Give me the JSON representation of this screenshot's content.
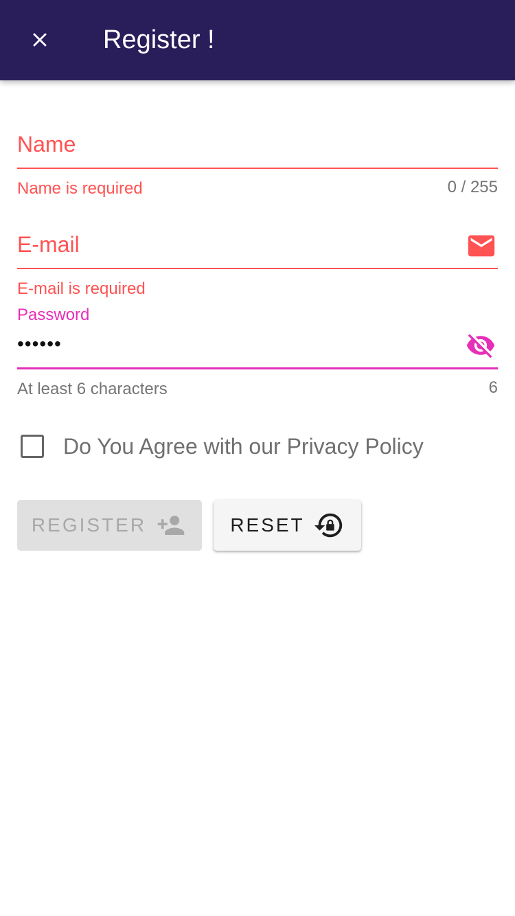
{
  "toolbar": {
    "title": "Register !",
    "close_icon": "close-icon",
    "background": "#291d5a"
  },
  "form": {
    "name": {
      "label": "Name",
      "value": "",
      "error": "Name is required",
      "counter": "0 / 255"
    },
    "email": {
      "label": "E-mail",
      "value": "",
      "error": "E-mail is required",
      "icon": "email-icon"
    },
    "password": {
      "label": "Password",
      "value_masked": "••••••",
      "hint": "At least 6 characters",
      "counter": "6",
      "icon": "eye-off-icon"
    },
    "privacy_checkbox": {
      "label": "Do You Agree with our Privacy Policy",
      "checked": false
    }
  },
  "buttons": {
    "register": {
      "label": "REGISTER",
      "icon": "account-plus-icon",
      "disabled": true
    },
    "reset": {
      "label": "RESET",
      "icon": "lock-reset-icon"
    }
  },
  "colors": {
    "error": "#ff5252",
    "focus": "#e62eb8",
    "disabled_bg": "#e0e0e0",
    "disabled_text": "#a8a8a8"
  }
}
